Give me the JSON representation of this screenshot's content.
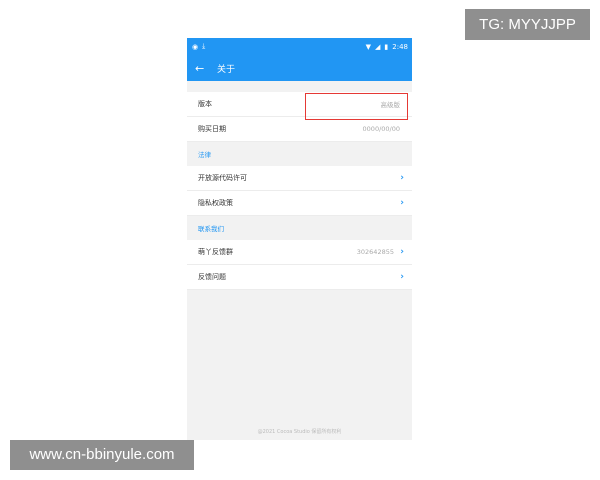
{
  "watermarks": {
    "tg": "TG: MYYJJPP",
    "url": "www.cn-bbinyule.com"
  },
  "statusbar": {
    "time": "2:48"
  },
  "appbar": {
    "back_icon": "←",
    "title": "关于"
  },
  "info_rows": [
    {
      "label": "版本",
      "value": "高级版"
    },
    {
      "label": "购买日期",
      "value": "0000/00/00"
    }
  ],
  "legal": {
    "header": "法律",
    "items": [
      {
        "label": "开放源代码许可"
      },
      {
        "label": "隐私权政策"
      }
    ]
  },
  "contact": {
    "header": "联系我们",
    "items": [
      {
        "label": "萌丫反馈群",
        "value": "302642855"
      },
      {
        "label": "反馈问题"
      }
    ]
  },
  "footer": "@2021 Cocoa Studio 保留所有权利",
  "colors": {
    "accent": "#2196f3",
    "highlight": "#e53935"
  }
}
